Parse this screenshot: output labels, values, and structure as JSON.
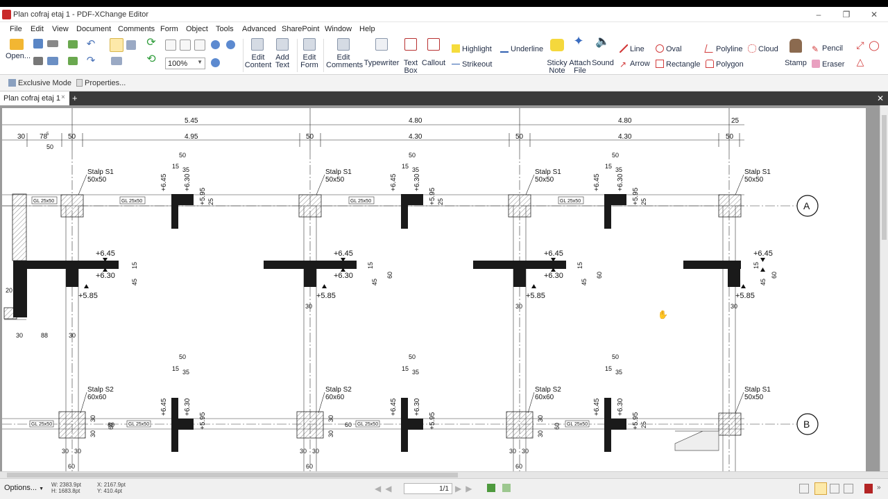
{
  "window": {
    "title": "Plan cofraj etaj 1 - PDF-XChange Editor"
  },
  "menu": [
    "File",
    "Edit",
    "View",
    "Document",
    "Comments",
    "Form",
    "Object",
    "Tools",
    "Advanced",
    "SharePoint",
    "Window",
    "Help"
  ],
  "ribbon": {
    "open": "Open...",
    "zoom_value": "100%",
    "edit_content": [
      "Edit",
      "Content"
    ],
    "add_text": [
      "Add",
      "Text"
    ],
    "edit_form": [
      "Edit",
      "Form"
    ],
    "edit_comments": [
      "Edit",
      "Comments"
    ],
    "typewriter": "Typewriter",
    "text_box": [
      "Text",
      "Box"
    ],
    "callout": "Callout",
    "highlight": "Highlight",
    "underline": "Underline",
    "strikeout": "Strikeout",
    "sticky_note": [
      "Sticky",
      "Note"
    ],
    "attach_file": [
      "Attach",
      "File"
    ],
    "sound": "Sound",
    "line": "Line",
    "arrow": "Arrow",
    "oval": "Oval",
    "rectangle": "Rectangle",
    "polyline": "Polyline",
    "polygon": "Polygon",
    "cloud": "Cloud",
    "stamp": "Stamp",
    "pencil": "Pencil",
    "eraser": "Eraser"
  },
  "toolbar2": {
    "exclusive_mode": "Exclusive Mode",
    "properties": "Properties..."
  },
  "tabs": [
    {
      "label": "Plan cofraj etaj 1"
    }
  ],
  "drawing": {
    "spans_top": [
      "5.45",
      "4.80",
      "4.80",
      "25"
    ],
    "spans_inner": [
      "30",
      "78",
      "5",
      "50",
      "4.95",
      "50",
      "4.30",
      "50",
      "4.30",
      "50"
    ],
    "stalp_s1": "Stalp S1",
    "stalp_s2": "Stalp S2",
    "size_50x50": "50x50",
    "size_60x60": "60x60",
    "beam_label": "GL 25x50",
    "beam_label_b": "GL 25x50",
    "elev_645": "+6.45",
    "elev_630": "+6.30",
    "elev_585": "+5.85",
    "elev_595": "+5.95",
    "dim_50": "50",
    "dim_15": "15",
    "dim_35": "35",
    "dim_25": "25",
    "dim_45": "45",
    "dim_60": "60",
    "dim_30": "30",
    "dim_20": "20",
    "dim_88": "88",
    "axis_a": "A",
    "axis_b": "B"
  },
  "status": {
    "options": "Options...",
    "w": "W: 2383.9pt",
    "h": "H: 1683.8pt",
    "x": "X: 2167.9pt",
    "y": "Y: 410.4pt",
    "page": "1/1"
  }
}
